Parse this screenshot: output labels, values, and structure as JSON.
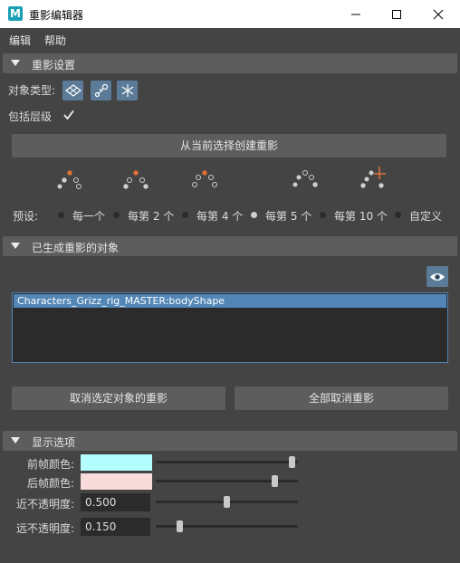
{
  "window": {
    "title": "重影编辑器",
    "app_icon_letter": "M"
  },
  "menu": {
    "items": [
      "编辑",
      "帮助"
    ]
  },
  "ghost_settings": {
    "header": "重影设置",
    "object_type_label": "对象类型:",
    "object_type_icons": [
      "mesh-icon",
      "joint-icon",
      "locator-icon"
    ],
    "include_hierarchy_label": "包括层级",
    "include_hierarchy_checked": true,
    "create_button": "从当前选择创建重影",
    "presets_label": "预设:",
    "presets": [
      "每一个",
      "每第 2 个",
      "每第 4 个",
      "每第 5 个",
      "每第 10 个",
      "自定义"
    ],
    "selected_preset": 3
  },
  "ghosted_objects": {
    "header": "已生成重影的对象",
    "items": [
      "Characters_Grizz_rig_MASTER:bodyShape"
    ],
    "unghost_selected_button": "取消选定对象的重影",
    "unghost_all_button": "全部取消重影"
  },
  "display_options": {
    "header": "显示选项",
    "pre_frame_color_label": "前帧颜色:",
    "pre_frame_color": "#b4feff",
    "post_frame_color_label": "后帧颜色:",
    "post_frame_color": "#f7dcdb",
    "near_opacity_label": "近不透明度:",
    "near_opacity_value": "0.500",
    "far_opacity_label": "远不透明度:",
    "far_opacity_value": "0.150",
    "pre_slider_level": 0.98,
    "post_slider_level": 0.85,
    "near_slider_level": 0.5,
    "far_slider_level": 0.15
  },
  "colors": {
    "accent": "#5286b6",
    "dot_orange": "#e07038",
    "background": "#444444"
  }
}
